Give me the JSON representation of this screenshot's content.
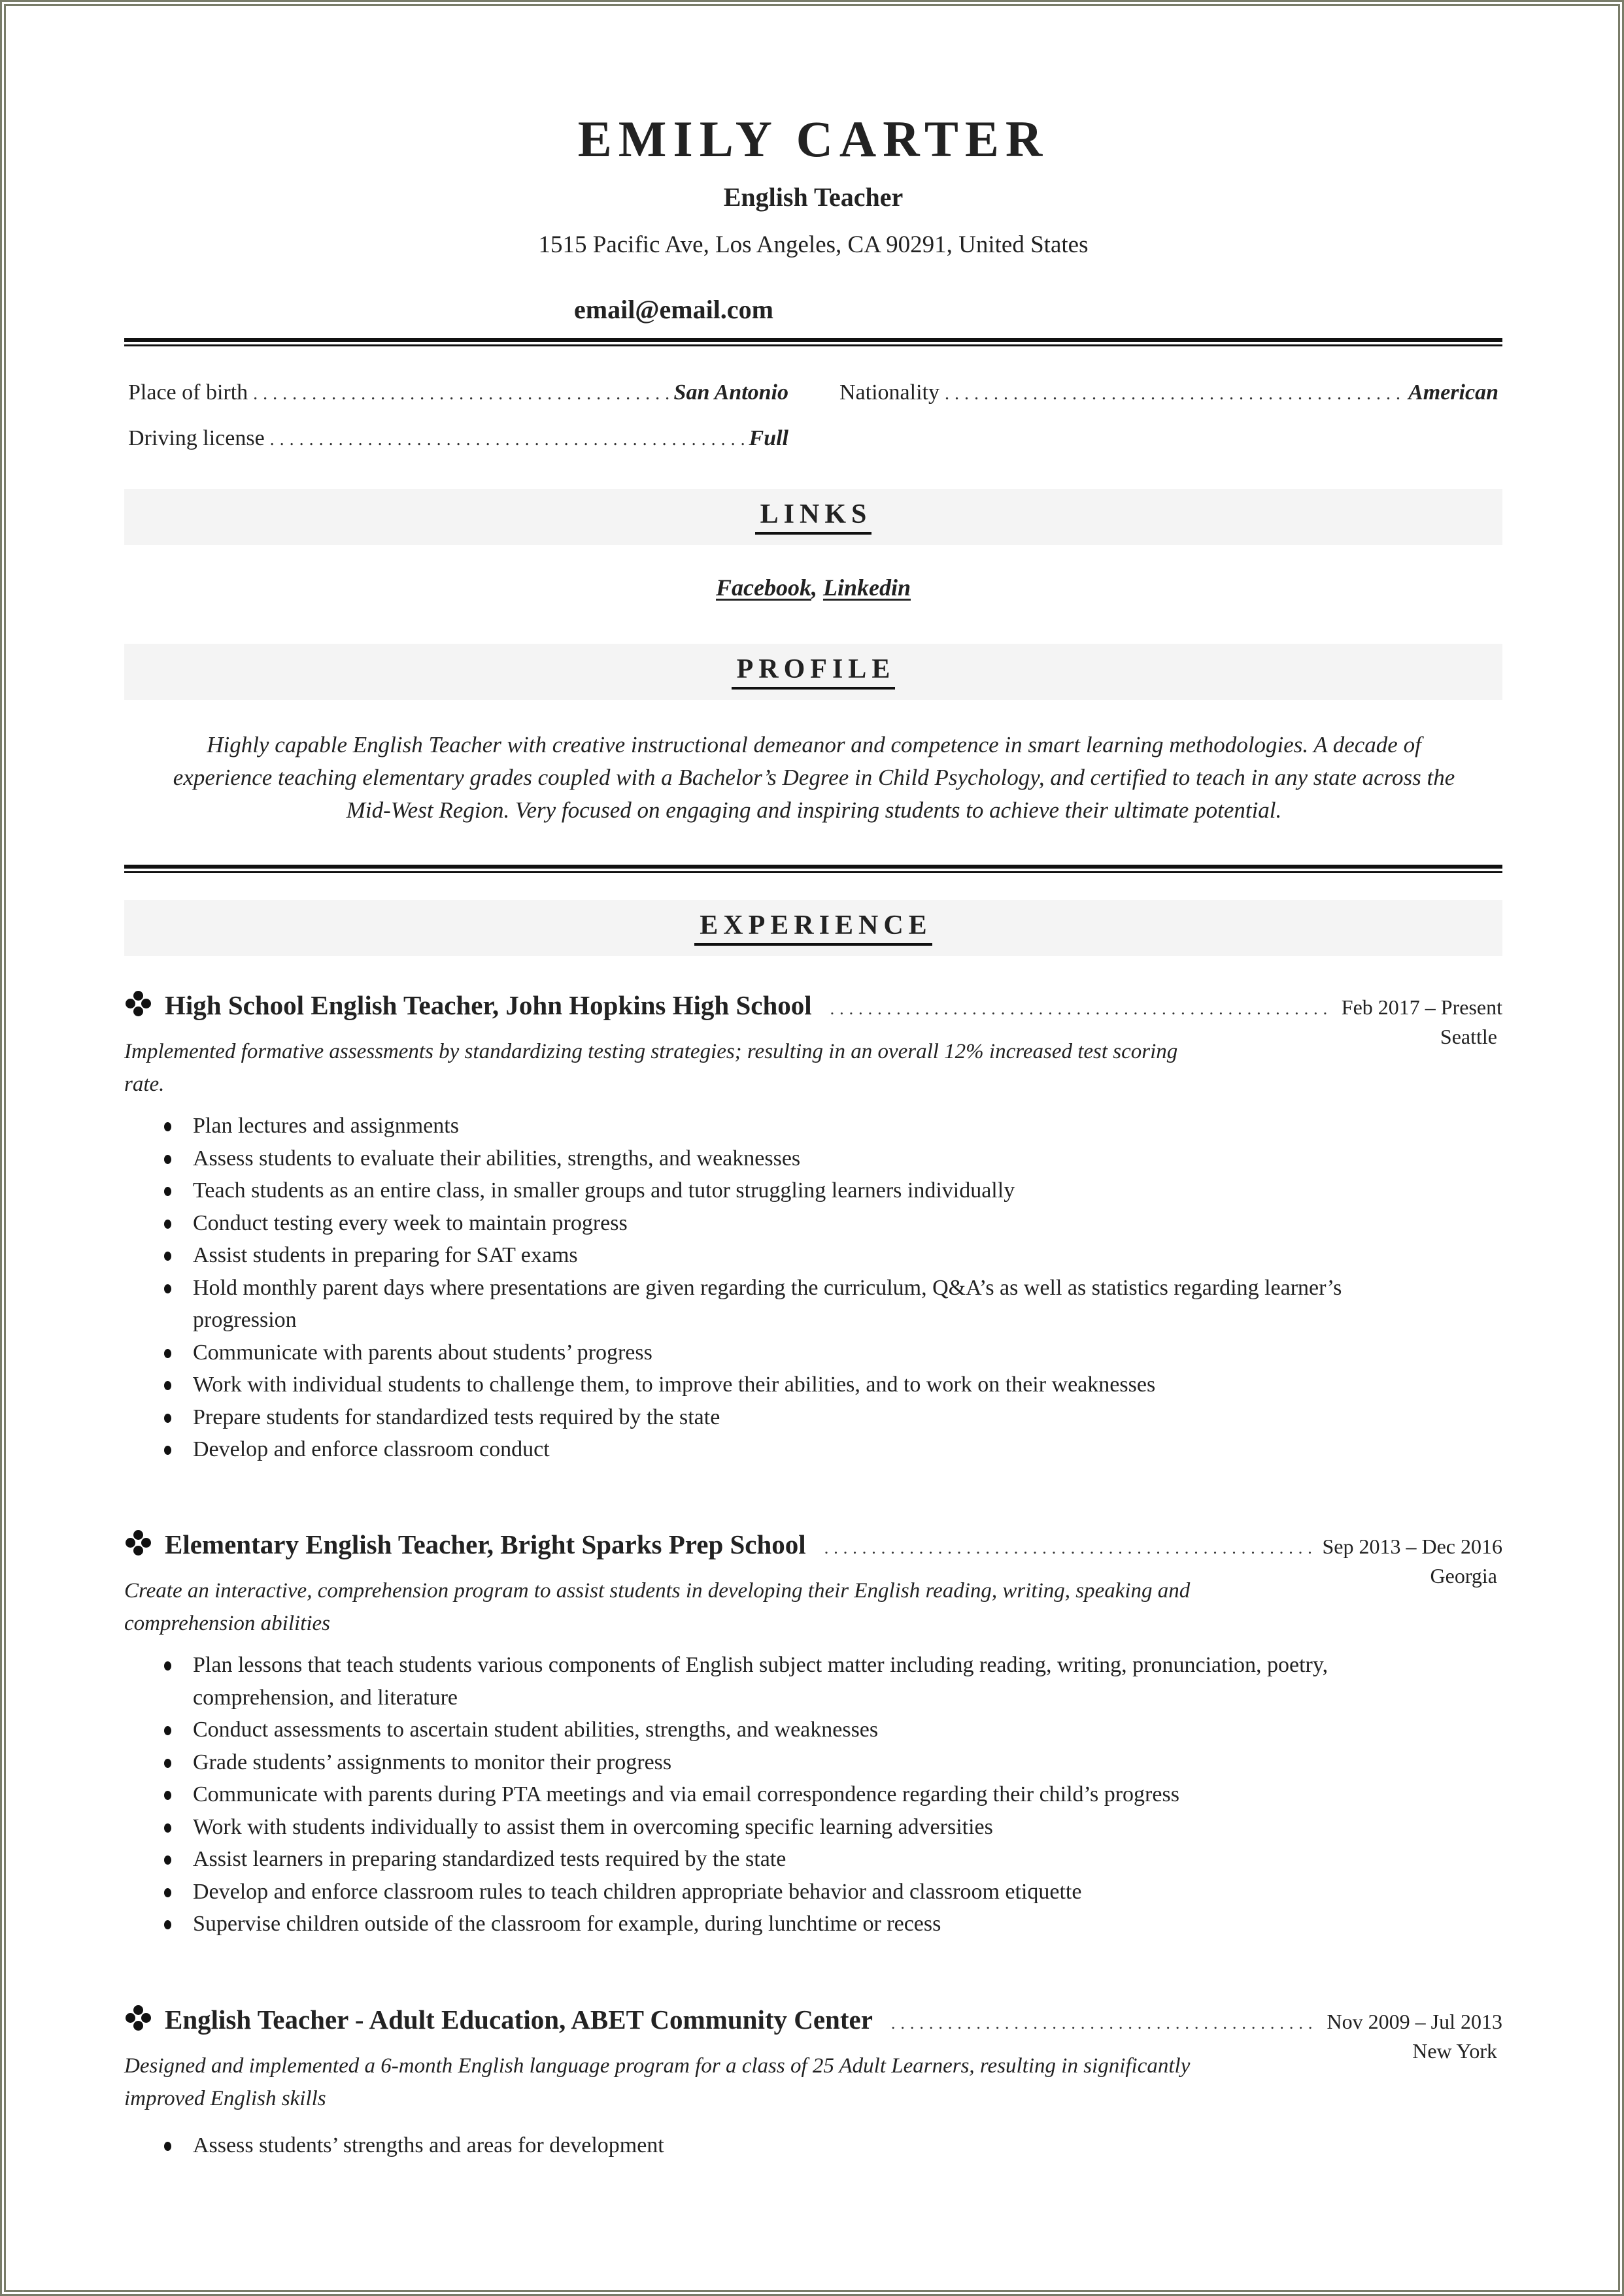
{
  "header": {
    "name": "EMILY CARTER",
    "title": "English Teacher",
    "address": "1515 Pacific Ave, Los Angeles, CA 90291, United States",
    "email": "email@email.com"
  },
  "personal_info": [
    {
      "label": "Place of birth",
      "value": "San Antonio"
    },
    {
      "label": "Nationality",
      "value": "American"
    },
    {
      "label": "Driving license",
      "value": "Full"
    }
  ],
  "links": {
    "heading": "LINKS",
    "items": [
      "Facebook",
      "Linkedin"
    ],
    "separator": ", "
  },
  "profile": {
    "heading": "PROFILE",
    "text": "Highly capable English Teacher with creative instructional demeanor and competence in smart learning methodologies. A decade of experience teaching elementary grades coupled with a Bachelor’s Degree in Child Psychology, and certified to teach in any state across the Mid-West Region. Very focused on engaging and inspiring students to achieve their ultimate potential."
  },
  "experience": {
    "heading": "EXPERIENCE",
    "jobs": [
      {
        "title": "High School English Teacher, John Hopkins High School",
        "dates": "Feb 2017 – Present",
        "location": "Seattle",
        "description": "Implemented formative assessments by standardizing testing strategies; resulting in an overall 12% increased test scoring rate.",
        "bullets": [
          "Plan lectures and assignments",
          "Assess students to evaluate their abilities, strengths, and weaknesses",
          "Teach students as an entire class, in smaller groups and tutor struggling learners individually",
          "Conduct testing every week to maintain progress",
          "Assist students in preparing for SAT exams",
          "Hold monthly parent days where presentations are given regarding the curriculum, Q&A’s as well as statistics regarding learner’s progression",
          "Communicate with parents about students’ progress",
          "Work with individual students to challenge them, to improve their abilities, and to work on their weaknesses",
          "Prepare students for standardized tests required by the state",
          "Develop and enforce classroom conduct"
        ]
      },
      {
        "title": "Elementary English Teacher, Bright Sparks Prep School",
        "dates": "Sep 2013 – Dec 2016",
        "location": "Georgia",
        "description": "Create an interactive, comprehension program to assist students in developing their English reading, writing, speaking and comprehension abilities",
        "bullets": [
          "Plan lessons that teach students various components of English subject matter including reading, writing, pronunciation, poetry, comprehension, and literature",
          "Conduct assessments to ascertain student abilities, strengths, and weaknesses",
          "Grade students’ assignments to monitor their progress",
          "Communicate with parents during PTA meetings and via email correspondence regarding their child’s progress",
          "Work with students individually to assist them in overcoming specific learning adversities",
          "Assist learners in preparing standardized tests required by the state",
          "Develop and enforce classroom rules to teach children appropriate behavior and classroom etiquette",
          "Supervise children outside of the classroom for example, during lunchtime or recess"
        ]
      },
      {
        "title": "English Teacher - Adult Education, ABET Community Center",
        "dates": "Nov 2009 – Jul 2013",
        "location": "New York",
        "description": "Designed and implemented a 6-month English language program for a class of 25 Adult Learners, resulting in significantly improved English skills",
        "bullets": [
          "Assess students’ strengths and areas for development"
        ]
      }
    ]
  },
  "icons": {
    "job_bullet": "four-dot-diamond-icon",
    "list_bullet": "bullet-dot"
  },
  "colors": {
    "text": "#222222",
    "section_bar": "#f4f4f4",
    "rule": "#111111",
    "page_border": "#7a7d6a"
  }
}
